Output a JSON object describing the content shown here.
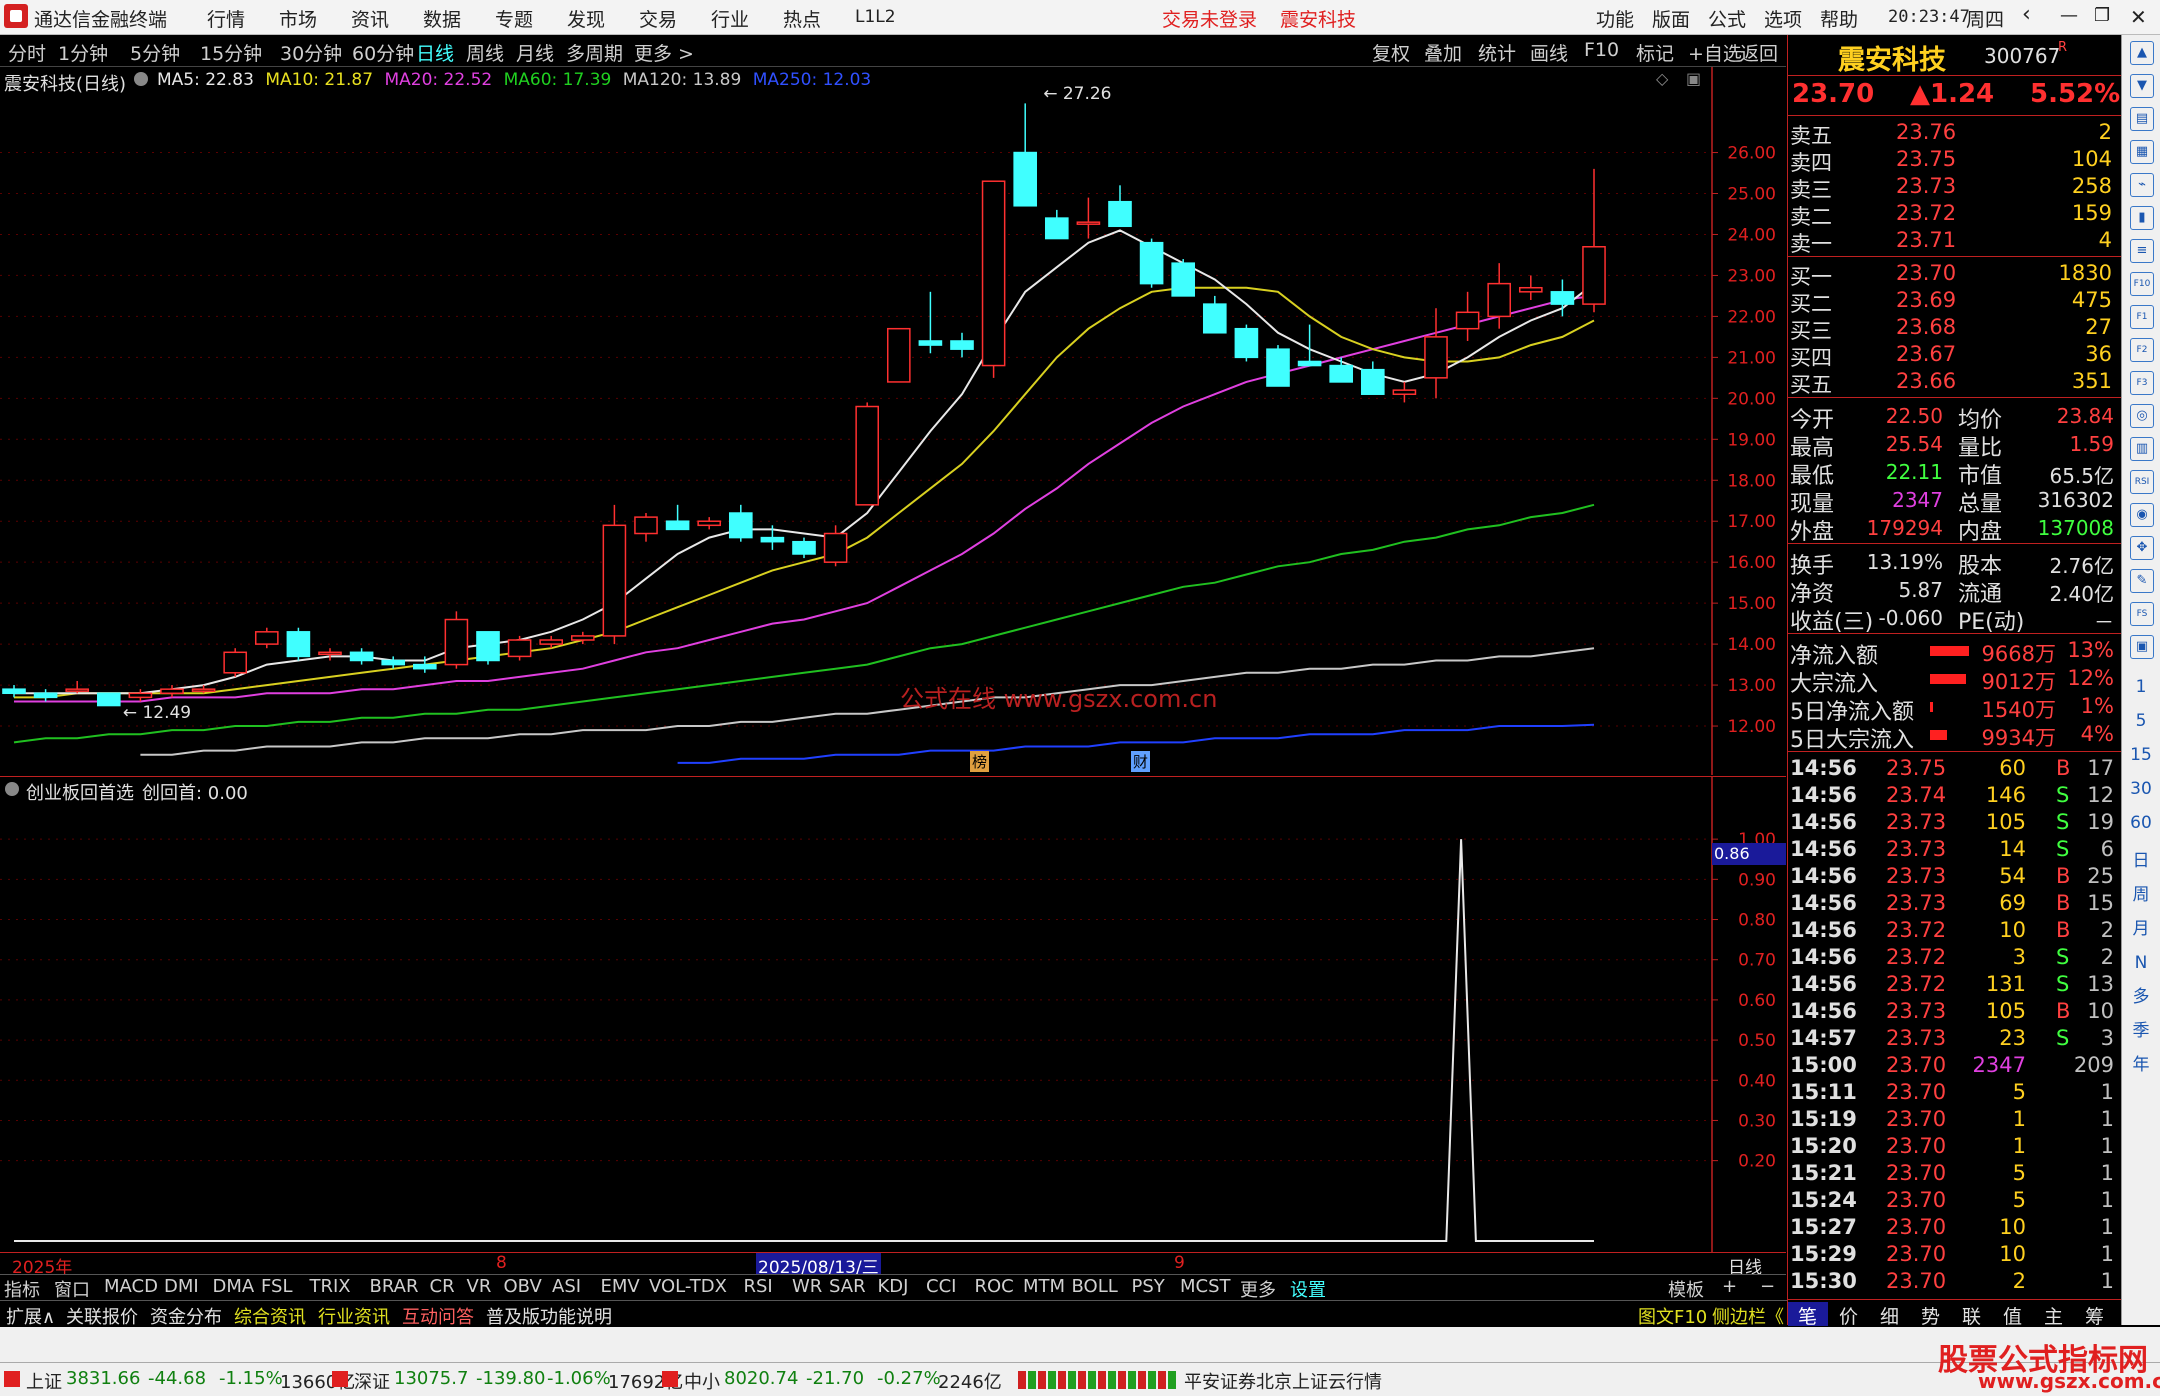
{
  "title_bar": {
    "app_name": "通达信金融终端",
    "menu": [
      "行情",
      "市场",
      "资讯",
      "数据",
      "专题",
      "发现",
      "交易",
      "行业",
      "热点",
      "L1L2"
    ],
    "login_status": "交易未登录",
    "stock_name": "震安科技",
    "right_menu": [
      "功能",
      "版面",
      "公式",
      "选项",
      "帮助"
    ],
    "time": "20:23:47",
    "weekday": "周四"
  },
  "period_bar": {
    "periods": [
      "分时",
      "1分钟",
      "5分钟",
      "15分钟",
      "30分钟",
      "60分钟",
      "日线",
      "周线",
      "月线",
      "多周期",
      "更多 >"
    ],
    "active": "日线",
    "tools": [
      "复权",
      "叠加",
      "统计",
      "画线",
      "F10",
      "标记",
      "+自选",
      "返回"
    ]
  },
  "main_chart": {
    "header": "震安科技(日线)",
    "ma": [
      {
        "label": "MA5: 22.83",
        "color": "#e8e8e8"
      },
      {
        "label": "MA10: 21.87",
        "color": "#e8e020"
      },
      {
        "label": "MA20: 22.52",
        "color": "#e040e0"
      },
      {
        "label": "MA60: 17.39",
        "color": "#20d020"
      },
      {
        "label": "MA120: 13.89",
        "color": "#c8c8c8"
      },
      {
        "label": "MA250: 12.03",
        "color": "#3050ff"
      }
    ],
    "high_label": "27.26",
    "low_label": "12.49",
    "watermark": "公式在线  www.gszx.com.cn",
    "markers": [
      "榜",
      "财"
    ],
    "y_ticks": [
      "26.00",
      "25.00",
      "24.00",
      "23.00",
      "22.00",
      "21.00",
      "20.00",
      "19.00",
      "18.00",
      "17.00",
      "16.00",
      "15.00",
      "14.00",
      "13.00",
      "12.00"
    ]
  },
  "chart_data": {
    "type": "candlestick",
    "ylim": [
      11.0,
      27.6
    ],
    "candles": [
      [
        12.9,
        13.0,
        12.7,
        12.8
      ],
      [
        12.8,
        12.9,
        12.6,
        12.7
      ],
      [
        12.9,
        13.1,
        12.8,
        12.9
      ],
      [
        12.8,
        12.8,
        12.5,
        12.5
      ],
      [
        12.7,
        12.9,
        12.6,
        12.8
      ],
      [
        12.8,
        13.0,
        12.7,
        12.9
      ],
      [
        12.9,
        13.0,
        12.8,
        12.9
      ],
      [
        13.3,
        13.9,
        13.2,
        13.8
      ],
      [
        14.0,
        14.4,
        13.9,
        14.3
      ],
      [
        14.3,
        14.4,
        13.6,
        13.7
      ],
      [
        13.8,
        13.9,
        13.6,
        13.8
      ],
      [
        13.8,
        13.9,
        13.5,
        13.6
      ],
      [
        13.6,
        13.7,
        13.4,
        13.5
      ],
      [
        13.5,
        13.7,
        13.3,
        13.4
      ],
      [
        13.5,
        14.8,
        13.4,
        14.6
      ],
      [
        14.3,
        14.3,
        13.5,
        13.6
      ],
      [
        13.7,
        14.2,
        13.6,
        14.1
      ],
      [
        14.0,
        14.2,
        13.9,
        14.1
      ],
      [
        14.1,
        14.3,
        14.0,
        14.2
      ],
      [
        14.2,
        17.4,
        14.0,
        16.9
      ],
      [
        16.7,
        17.2,
        16.5,
        17.1
      ],
      [
        17.0,
        17.4,
        16.8,
        16.8
      ],
      [
        16.9,
        17.1,
        16.8,
        17.0
      ],
      [
        17.2,
        17.4,
        16.5,
        16.6
      ],
      [
        16.6,
        16.9,
        16.3,
        16.5
      ],
      [
        16.5,
        16.6,
        16.1,
        16.2
      ],
      [
        16.0,
        16.9,
        15.9,
        16.7
      ],
      [
        17.4,
        19.9,
        17.4,
        19.8
      ],
      [
        20.4,
        21.7,
        20.4,
        21.7
      ],
      [
        21.4,
        22.6,
        21.1,
        21.3
      ],
      [
        21.4,
        21.6,
        21.0,
        21.2
      ],
      [
        20.8,
        25.3,
        20.5,
        25.3
      ],
      [
        26.0,
        27.2,
        24.8,
        24.7
      ],
      [
        24.4,
        24.6,
        24.0,
        23.9
      ],
      [
        24.3,
        24.9,
        23.9,
        24.3
      ],
      [
        24.8,
        25.2,
        24.2,
        24.2
      ],
      [
        23.8,
        23.9,
        22.7,
        22.8
      ],
      [
        23.3,
        23.4,
        22.6,
        22.5
      ],
      [
        22.3,
        22.5,
        21.6,
        21.6
      ],
      [
        21.7,
        21.8,
        20.9,
        21.0
      ],
      [
        21.2,
        21.3,
        20.3,
        20.3
      ],
      [
        20.9,
        21.8,
        20.8,
        20.8
      ],
      [
        20.8,
        21.0,
        20.4,
        20.4
      ],
      [
        20.7,
        20.9,
        20.1,
        20.1
      ],
      [
        20.1,
        20.4,
        19.9,
        20.2
      ],
      [
        20.5,
        22.2,
        20.0,
        21.5
      ],
      [
        21.7,
        22.6,
        21.4,
        22.1
      ],
      [
        22.0,
        23.3,
        21.7,
        22.8
      ],
      [
        22.6,
        23.0,
        22.4,
        22.7
      ],
      [
        22.6,
        22.9,
        22.0,
        22.3
      ],
      [
        22.3,
        25.6,
        22.1,
        23.7
      ]
    ],
    "ma5": [
      12.8,
      12.8,
      12.8,
      12.8,
      12.8,
      12.9,
      13.0,
      13.2,
      13.5,
      13.6,
      13.7,
      13.7,
      13.6,
      13.6,
      13.9,
      14.0,
      14.1,
      14.3,
      14.6,
      15.0,
      15.6,
      16.2,
      16.6,
      16.8,
      16.8,
      16.7,
      16.6,
      17.2,
      18.2,
      19.2,
      20.1,
      21.4,
      22.6,
      23.2,
      23.8,
      24.1,
      23.7,
      23.3,
      22.9,
      22.3,
      21.6,
      21.2,
      20.9,
      20.6,
      20.4,
      20.6,
      21.0,
      21.5,
      21.9,
      22.2,
      22.8
    ],
    "ma10": [
      12.7,
      12.7,
      12.8,
      12.8,
      12.8,
      12.8,
      12.8,
      12.9,
      13.0,
      13.1,
      13.2,
      13.3,
      13.4,
      13.5,
      13.6,
      13.7,
      13.8,
      13.9,
      14.1,
      14.3,
      14.6,
      14.9,
      15.2,
      15.5,
      15.8,
      16.0,
      16.2,
      16.6,
      17.2,
      17.8,
      18.4,
      19.2,
      20.1,
      21.0,
      21.7,
      22.2,
      22.6,
      22.7,
      22.7,
      22.7,
      22.6,
      22.0,
      21.5,
      21.2,
      21.0,
      20.9,
      20.9,
      21.0,
      21.3,
      21.5,
      21.9
    ],
    "ma20": [
      12.6,
      12.6,
      12.6,
      12.6,
      12.6,
      12.7,
      12.7,
      12.7,
      12.8,
      12.8,
      12.8,
      12.9,
      12.9,
      13.0,
      13.1,
      13.1,
      13.2,
      13.3,
      13.4,
      13.6,
      13.8,
      13.9,
      14.1,
      14.3,
      14.5,
      14.6,
      14.8,
      15.0,
      15.4,
      15.8,
      16.2,
      16.7,
      17.3,
      17.8,
      18.4,
      18.9,
      19.4,
      19.8,
      20.1,
      20.4,
      20.6,
      20.8,
      21.0,
      21.2,
      21.4,
      21.6,
      21.8,
      22.0,
      22.2,
      22.4,
      22.5
    ],
    "ma60": [
      11.6,
      11.7,
      11.7,
      11.8,
      11.8,
      11.9,
      11.9,
      12.0,
      12.0,
      12.1,
      12.1,
      12.2,
      12.2,
      12.3,
      12.3,
      12.4,
      12.4,
      12.5,
      12.6,
      12.7,
      12.8,
      12.9,
      13.0,
      13.1,
      13.2,
      13.3,
      13.4,
      13.5,
      13.7,
      13.9,
      14.0,
      14.2,
      14.4,
      14.6,
      14.8,
      15.0,
      15.2,
      15.4,
      15.5,
      15.7,
      15.9,
      16.0,
      16.2,
      16.3,
      16.5,
      16.6,
      16.8,
      16.9,
      17.1,
      17.2,
      17.4
    ],
    "ma120": [
      11.3,
      11.3,
      11.4,
      11.4,
      11.5,
      11.5,
      11.5,
      11.6,
      11.6,
      11.7,
      11.7,
      11.7,
      11.8,
      11.8,
      11.9,
      11.9,
      11.9,
      12.0,
      12.0,
      12.1,
      12.1,
      12.2,
      12.3,
      12.3,
      12.4,
      12.5,
      12.6,
      12.7,
      12.7,
      12.8,
      12.9,
      13.0,
      13.0,
      13.1,
      13.2,
      13.3,
      13.3,
      13.4,
      13.4,
      13.5,
      13.5,
      13.6,
      13.6,
      13.7,
      13.7,
      13.8,
      13.9
    ],
    "ma250": [
      11.1,
      11.1,
      11.2,
      11.2,
      11.2,
      11.3,
      11.3,
      11.3,
      11.4,
      11.4,
      11.4,
      11.5,
      11.5,
      11.5,
      11.6,
      11.6,
      11.6,
      11.7,
      11.7,
      11.7,
      11.8,
      11.8,
      11.8,
      11.9,
      11.9,
      11.9,
      12.0,
      12.0,
      12.0,
      12.03
    ],
    "indicator": {
      "name": "创业板回首选",
      "value_label": "创回首: 0.00",
      "ylim": [
        0,
        1.08
      ],
      "y_ticks": [
        "1.00",
        "0.90",
        "0.80",
        "0.70",
        "0.60",
        "0.50",
        "0.40",
        "0.30",
        "0.20"
      ],
      "cursor_value": "0.86",
      "values": [
        0,
        0,
        0,
        0,
        0,
        0,
        0,
        0,
        0,
        0,
        0,
        0,
        0,
        0,
        0,
        0,
        0,
        0,
        0,
        0,
        0,
        0,
        0,
        0,
        0,
        0,
        0,
        0,
        0,
        0,
        0,
        0,
        0,
        0,
        0,
        0,
        0,
        0,
        0,
        0,
        0,
        0,
        0,
        0,
        0,
        0,
        0,
        0,
        0,
        0,
        0,
        0,
        0,
        0,
        0,
        0,
        0,
        0,
        0,
        0,
        0,
        0,
        0,
        0,
        0,
        0,
        0,
        0,
        0,
        0,
        0,
        0,
        0,
        0,
        0,
        0,
        0,
        0,
        0,
        0,
        0,
        0,
        0,
        0,
        0,
        0,
        0,
        0,
        0,
        0,
        0,
        0,
        0,
        0,
        0,
        0,
        0,
        0,
        1,
        0,
        0,
        0,
        0,
        0,
        0,
        0,
        0,
        0
      ]
    },
    "x_labels": [
      "2025年",
      "8",
      "2025/08/13/三",
      "9"
    ]
  },
  "right_panel": {
    "stock_name": "震安科技",
    "stock_code": "300767",
    "code_badge": "R",
    "price": "23.70",
    "change": "▲1.24",
    "change_pct": "5.52%",
    "asks": [
      {
        "label": "卖五",
        "price": "23.76",
        "vol": "2"
      },
      {
        "label": "卖四",
        "price": "23.75",
        "vol": "104"
      },
      {
        "label": "卖三",
        "price": "23.73",
        "vol": "258"
      },
      {
        "label": "卖二",
        "price": "23.72",
        "vol": "159"
      },
      {
        "label": "卖一",
        "price": "23.71",
        "vol": "4"
      }
    ],
    "bids": [
      {
        "label": "买一",
        "price": "23.70",
        "vol": "1830"
      },
      {
        "label": "买二",
        "price": "23.69",
        "vol": "475"
      },
      {
        "label": "买三",
        "price": "23.68",
        "vol": "27"
      },
      {
        "label": "买四",
        "price": "23.67",
        "vol": "36"
      },
      {
        "label": "买五",
        "price": "23.66",
        "vol": "351"
      }
    ],
    "stats1": [
      {
        "l1": "今开",
        "v1": "22.50",
        "c1": "#ff4040",
        "l2": "均价",
        "v2": "23.84",
        "c2": "#ff4040"
      },
      {
        "l1": "最高",
        "v1": "25.54",
        "c1": "#ff4040",
        "l2": "量比",
        "v2": "1.59",
        "c2": "#ff4040"
      },
      {
        "l1": "最低",
        "v1": "22.11",
        "c1": "#40ff40",
        "l2": "市值",
        "v2": "65.5亿",
        "c2": "#e0e0e0"
      },
      {
        "l1": "现量",
        "v1": "2347",
        "c1": "#e040e0",
        "l2": "总量",
        "v2": "316302",
        "c2": "#e0e0e0"
      },
      {
        "l1": "外盘",
        "v1": "179294",
        "c1": "#ff4040",
        "l2": "内盘",
        "v2": "137008",
        "c2": "#40ff40"
      }
    ],
    "stats2": [
      {
        "l1": "换手",
        "v1": "13.19%",
        "l2": "股本",
        "v2": "2.76亿"
      },
      {
        "l1": "净资",
        "v1": "5.87",
        "l2": "流通",
        "v2": "2.40亿"
      },
      {
        "l1": "收益(三)",
        "v1": "-0.060",
        "l2": "PE(动)",
        "v2": "－"
      }
    ],
    "flows": [
      {
        "label": "净流入额",
        "value": "9668万",
        "pct": "13%",
        "bar": 0.7
      },
      {
        "label": "大宗流入",
        "value": "9012万",
        "pct": "12%",
        "bar": 0.65
      },
      {
        "label": "5日净流入额",
        "value": "1540万",
        "pct": "1%",
        "bar": 0.05
      },
      {
        "label": "5日大宗流入",
        "value": "9934万",
        "pct": "4%",
        "bar": 0.3
      }
    ],
    "ticks": [
      {
        "t": "14:56",
        "p": "23.75",
        "v": "60",
        "bs": "B",
        "n": "17"
      },
      {
        "t": "14:56",
        "p": "23.74",
        "v": "146",
        "bs": "S",
        "n": "12"
      },
      {
        "t": "14:56",
        "p": "23.73",
        "v": "105",
        "bs": "S",
        "n": "19"
      },
      {
        "t": "14:56",
        "p": "23.73",
        "v": "14",
        "bs": "S",
        "n": "6"
      },
      {
        "t": "14:56",
        "p": "23.73",
        "v": "54",
        "bs": "B",
        "n": "25"
      },
      {
        "t": "14:56",
        "p": "23.73",
        "v": "69",
        "bs": "B",
        "n": "15"
      },
      {
        "t": "14:56",
        "p": "23.72",
        "v": "10",
        "bs": "B",
        "n": "2"
      },
      {
        "t": "14:56",
        "p": "23.72",
        "v": "3",
        "bs": "S",
        "n": "2"
      },
      {
        "t": "14:56",
        "p": "23.72",
        "v": "131",
        "bs": "S",
        "n": "13"
      },
      {
        "t": "14:56",
        "p": "23.73",
        "v": "105",
        "bs": "B",
        "n": "10"
      },
      {
        "t": "14:57",
        "p": "23.73",
        "v": "23",
        "bs": "S",
        "n": "3"
      },
      {
        "t": "15:00",
        "p": "23.70",
        "v": "2347",
        "bs": "",
        "n": "209"
      },
      {
        "t": "15:11",
        "p": "23.70",
        "v": "5",
        "bs": "",
        "n": "1"
      },
      {
        "t": "15:19",
        "p": "23.70",
        "v": "1",
        "bs": "",
        "n": "1"
      },
      {
        "t": "15:20",
        "p": "23.70",
        "v": "1",
        "bs": "",
        "n": "1"
      },
      {
        "t": "15:21",
        "p": "23.70",
        "v": "5",
        "bs": "",
        "n": "1"
      },
      {
        "t": "15:24",
        "p": "23.70",
        "v": "5",
        "bs": "",
        "n": "1"
      },
      {
        "t": "15:27",
        "p": "23.70",
        "v": "10",
        "bs": "",
        "n": "1"
      },
      {
        "t": "15:29",
        "p": "23.70",
        "v": "10",
        "bs": "",
        "n": "1"
      },
      {
        "t": "15:30",
        "p": "23.70",
        "v": "2",
        "bs": "",
        "n": "1"
      }
    ],
    "tabs": [
      "笔",
      "价",
      "细",
      "势",
      "联",
      "值",
      "主",
      "筹"
    ]
  },
  "side_icons": [
    "up-arrow-icon",
    "down-arrow-icon",
    "chart-icon",
    "table-icon",
    "line-chart-icon",
    "candle-icon",
    "list-icon",
    "f10-icon",
    "f1-icon",
    "f2-icon",
    "f3-icon",
    "circle-icon",
    "bar-icon",
    "rsi-icon",
    "bell-icon",
    "move-icon",
    "pen-icon",
    "fs-icon",
    "app-icon"
  ],
  "side_numbers": [
    "1",
    "5",
    "15",
    "30",
    "60"
  ],
  "side_chars": [
    "日",
    "周",
    "月",
    "N",
    "多",
    "季",
    "年"
  ],
  "indicator_bar": {
    "items": [
      "指标",
      "窗口",
      "MACD",
      "DMI",
      "DMA",
      "FSL",
      "TRIX",
      "BRAR",
      "CR",
      "VR",
      "OBV",
      "ASI",
      "EMV",
      "VOL-TDX",
      "RSI",
      "WR",
      "SAR",
      "KDJ",
      "CCI",
      "ROC",
      "MTM",
      "BOLL",
      "PSY",
      "MCST",
      "更多",
      "设置"
    ],
    "template_label": "模板",
    "right_label": "日线"
  },
  "ext_bar": {
    "items": [
      "扩展∧",
      "关联报价",
      "资金分布",
      "综合资讯",
      "行业资讯",
      "互动问答",
      "普及版功能说明"
    ],
    "right": [
      "图文F10",
      "侧边栏《"
    ]
  },
  "status_bar": {
    "indices": [
      {
        "name": "上证",
        "value": "3831.66",
        "chg": "-44.68",
        "pct": "-1.15%",
        "amt": "13660亿"
      },
      {
        "name": "深证",
        "value": "13075.7",
        "chg": "-139.80",
        "pct": "-1.06%",
        "amt": "17692亿"
      },
      {
        "name": "中小",
        "value": "8020.74",
        "chg": "-21.70",
        "pct": "-0.27%",
        "amt": "2246亿"
      }
    ],
    "broker": "平安证券北京上证云行情",
    "brand": "股票公式指标网",
    "brand_url": "www.gszx.com.cn"
  },
  "colors": {
    "up": "#ff3030",
    "down": "#40ffff",
    "grid": "#7a0000",
    "axis": "#c02020"
  }
}
